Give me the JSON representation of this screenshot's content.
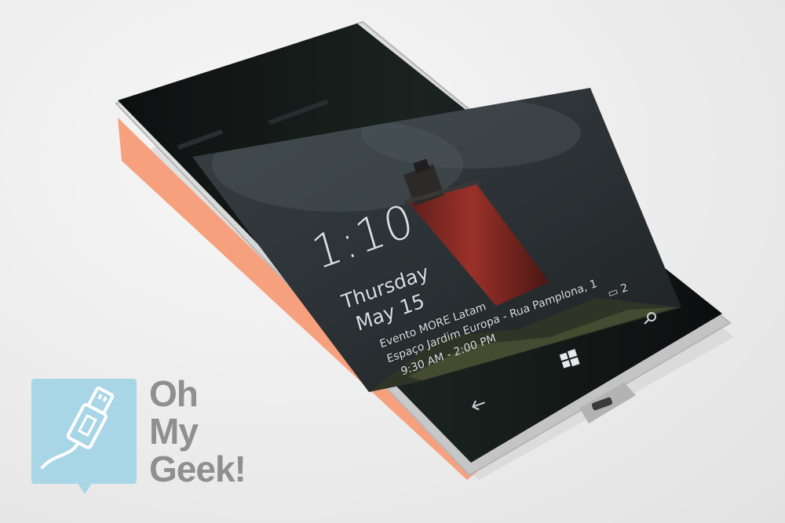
{
  "lockscreen": {
    "time": "1:10",
    "day": "Thursday",
    "date": "May 15",
    "event_title": "Evento MORE Latam",
    "event_location": "Espaço Jardim Europa - Rua Pamplona, 1",
    "event_time": "9:30 AM - 2:00 PM",
    "notification_count": "2"
  },
  "navbar": {
    "back_icon": "back-arrow-icon",
    "start_icon": "windows-logo-icon",
    "search_icon": "search-icon"
  },
  "logo": {
    "line1": "Oh",
    "line2": "My",
    "line3": "Geek!",
    "tile_color": "#a9d6e6",
    "text_color": "#8f8f8f"
  },
  "colors": {
    "phone_frame": "#d6d6d6",
    "phone_accent": "#f6a07e",
    "screen": "#1c1f22",
    "lighthouse": "#8a2b25"
  }
}
